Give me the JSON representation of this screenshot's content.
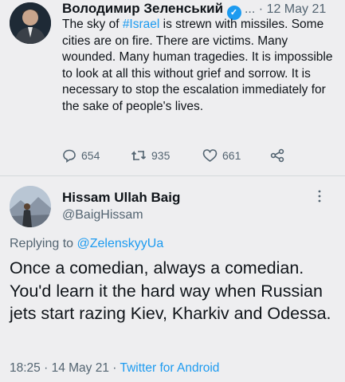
{
  "tweet": {
    "author": "Володимир Зеленський",
    "ellipsis": "...",
    "separator": "·",
    "date": "12 May 21",
    "text_before": "The sky of ",
    "hashtag": "#Israel",
    "text_after": " is strewn with missiles. Some cities are on fire. There are victims. Many wounded. Many human tragedies. It is impossible to look at all this without grief and sorrow. It is necessary to stop the escalation immediately for the sake of people's lives.",
    "replies": "654",
    "retweets": "935",
    "likes": "661"
  },
  "reply": {
    "author": "Hissam Ullah Baig",
    "handle": "@BaigHissam",
    "replying_to_label": "Replying to",
    "replying_to_handle": "@ZelenskyyUa",
    "text": "Once a comedian, always a comedian. You'd learn it the hard way when Russian jets start razing Kiev, Kharkiv and Odessa.",
    "time": "18:25",
    "date": "14 May 21",
    "separator": "·",
    "source": "Twitter for Android"
  },
  "colors": {
    "link": "#1d9bf0",
    "muted": "#536471",
    "text": "#0f1419",
    "background": "#eeeef0"
  },
  "icons": [
    "verified-badge-icon",
    "reply-icon",
    "retweet-icon",
    "like-icon",
    "share-icon",
    "more-options-icon"
  ]
}
